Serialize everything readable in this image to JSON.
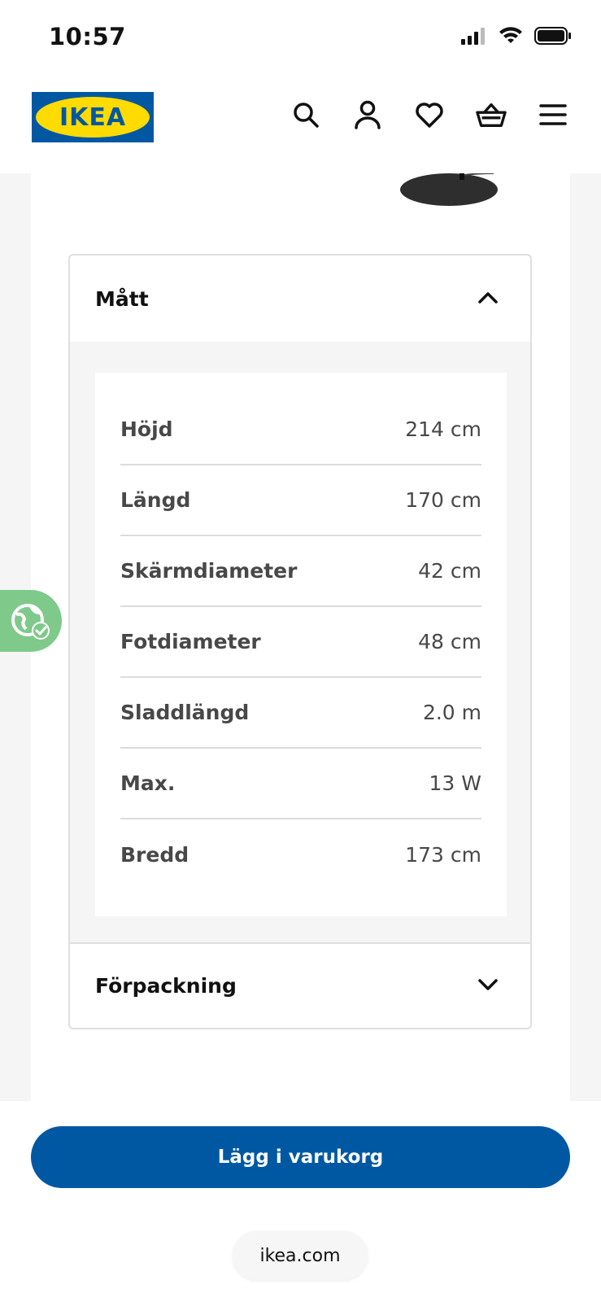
{
  "status_bar": {
    "time": "10:57",
    "icons": [
      "signal-icon",
      "wifi-icon",
      "battery-icon"
    ]
  },
  "header": {
    "logo_text": "IKEA",
    "icons": [
      "search-icon",
      "account-icon",
      "heart-icon",
      "cart-icon",
      "menu-icon"
    ]
  },
  "colors": {
    "brand_blue": "#0058a3",
    "brand_yellow": "#ffdb00",
    "eco_green": "#7fc98a"
  },
  "dimensions_section": {
    "title": "Mått",
    "expanded": true,
    "rows": [
      {
        "label": "Höjd",
        "value": "214 cm"
      },
      {
        "label": "Längd",
        "value": "170 cm"
      },
      {
        "label": "Skärmdiameter",
        "value": "42 cm"
      },
      {
        "label": "Fotdiameter",
        "value": "48 cm"
      },
      {
        "label": "Sladdlängd",
        "value": "2.0 m"
      },
      {
        "label": "Max.",
        "value": "13 W"
      },
      {
        "label": "Bredd",
        "value": "173 cm"
      }
    ]
  },
  "packaging_section": {
    "title": "Förpackning",
    "expanded": false
  },
  "add_to_cart_label": "Lägg i varukorg",
  "browser_url": "ikea.com"
}
